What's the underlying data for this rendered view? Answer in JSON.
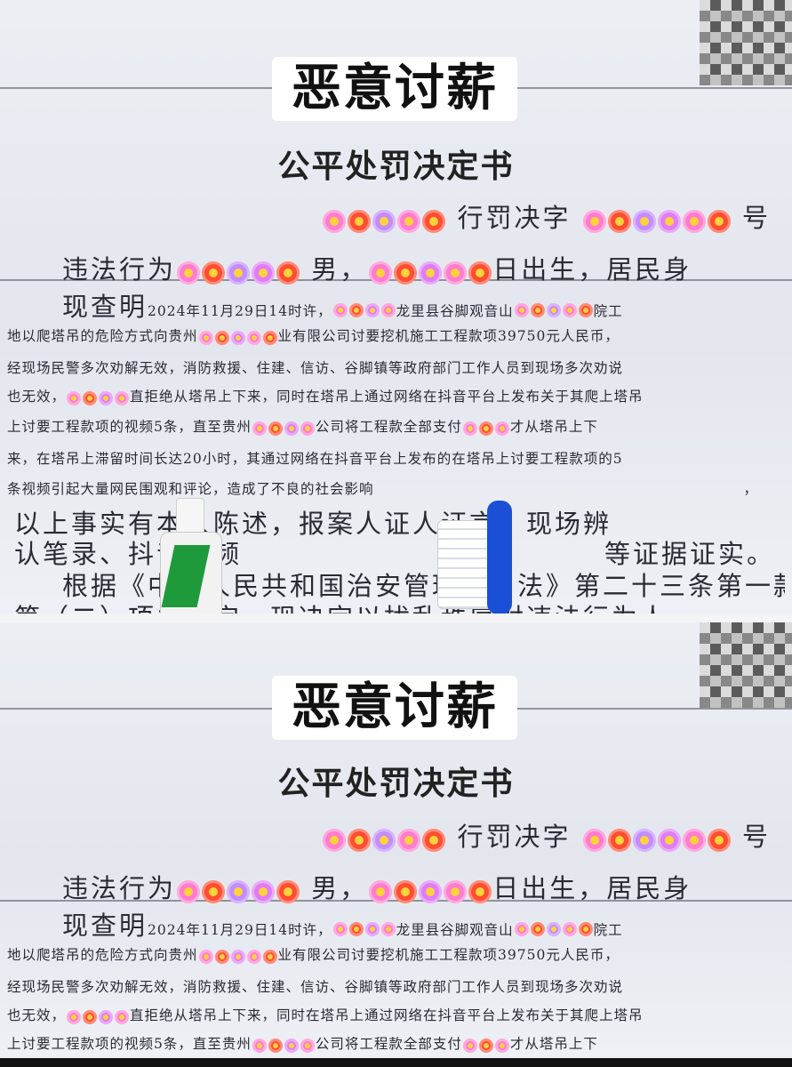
{
  "headline": "恶意讨薪",
  "document": {
    "title": "公平处罚决定书",
    "ref_middle": "行罚决字",
    "ref_end": "号",
    "line_violator_prefix": "违法行为",
    "line_violator_gender": "男，",
    "line_violator_suffix": "日出生，居民身",
    "finding_prefix": "现查明",
    "finding_line1": "2024年11月29日14时许，",
    "finding_line1b": "龙里县谷脚观音山",
    "finding_line1c": "院工",
    "finding_line2a": "地以爬塔吊的危险方式向贵州",
    "finding_line2b": "业有限公司讨要挖机施工工程款项39750元人民币，",
    "finding_line3": "经现场民警多次劝解无效，消防救援、住建、信访、谷脚镇等政府部门工作人员到现场多次劝说",
    "finding_line4a": "也无效，",
    "finding_line4b": "直拒绝从塔吊上下来，同时在塔吊上通过网络在抖音平台上发布关于其爬上塔吊",
    "finding_line5a": "上讨要工程款项的视频5条，直至贵州",
    "finding_line5b": "公司将工程款全部支付",
    "finding_line5c": "才从塔吊上下",
    "finding_line6": "来，在塔吊上滞留时间长达20小时，其通过网络在抖音平台上发布的在塔吊上讨要工程款项的5",
    "finding_line7": "条视频引起大量网民围观和评论，造成了不良的社会影响",
    "finding_line7_end": "，",
    "evidence_line1": "以上事实有本人陈述，报案人证人证言、现场辨",
    "evidence_line2a": "认笔录、抖音视频",
    "evidence_line2b": "等证据证实。",
    "basis_line1": "根据《中华人民共和国治安管理处罚法》第二十三条第一款",
    "basis_line2": "第（二）项之规定，现决定以扰乱秩序对违法行为人"
  }
}
